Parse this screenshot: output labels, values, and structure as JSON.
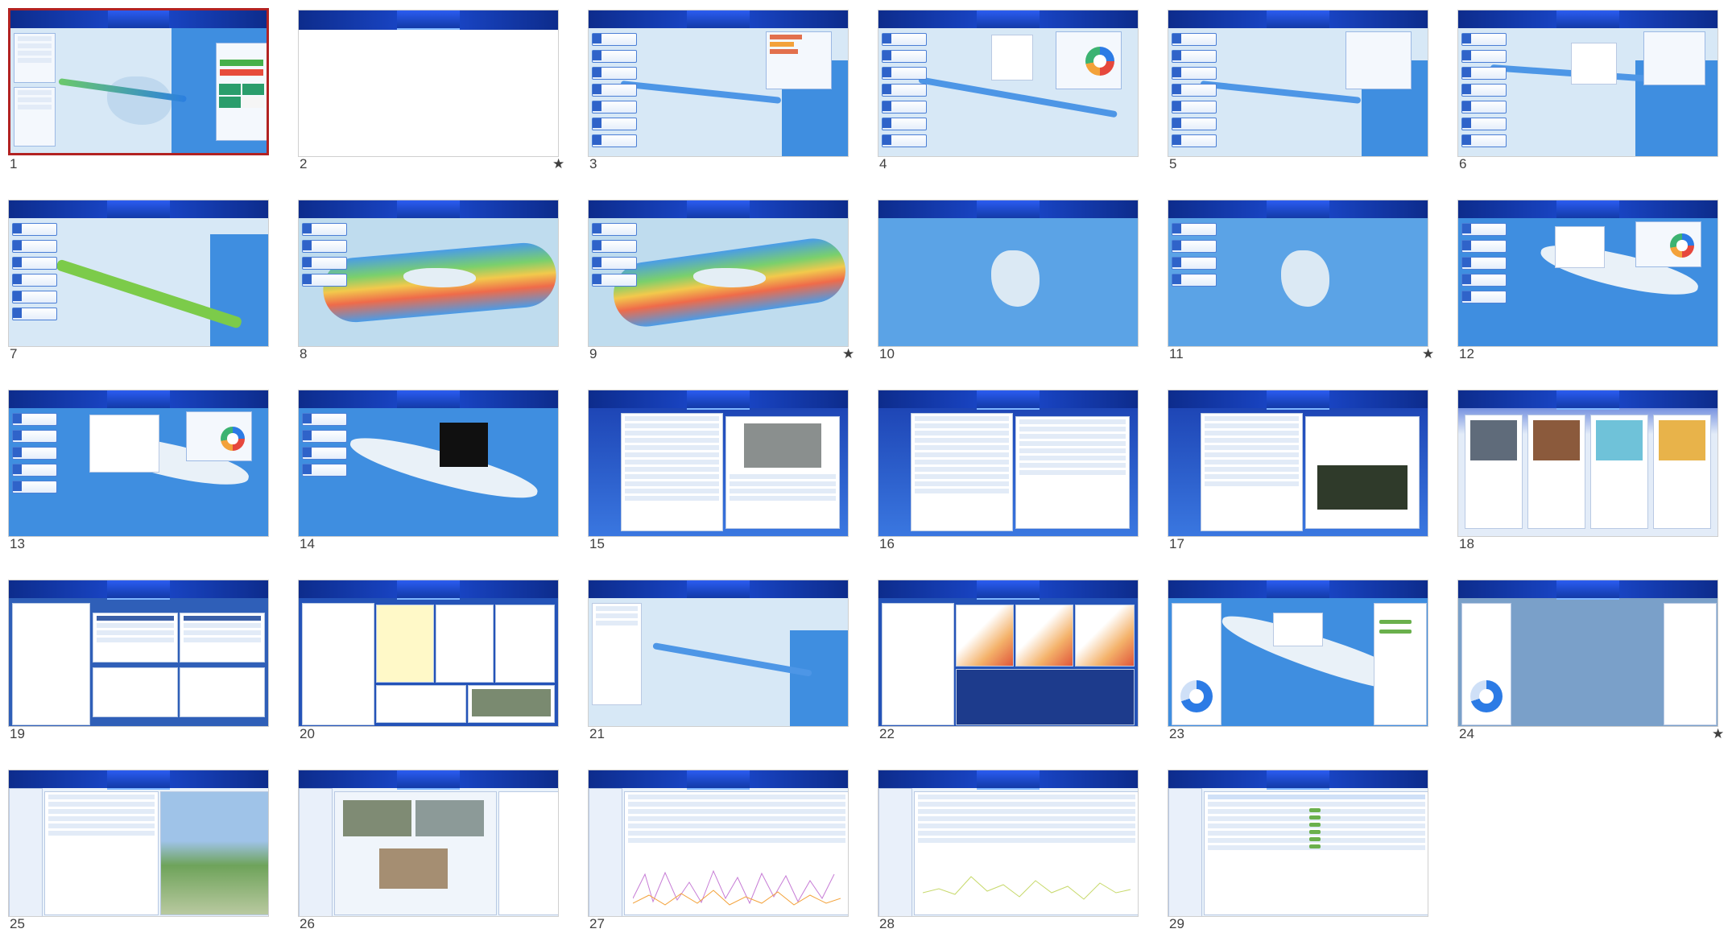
{
  "slides": [
    {
      "num": "1",
      "starred": false,
      "selected": true
    },
    {
      "num": "2",
      "starred": true,
      "selected": false
    },
    {
      "num": "3",
      "starred": false,
      "selected": false
    },
    {
      "num": "4",
      "starred": false,
      "selected": false
    },
    {
      "num": "5",
      "starred": false,
      "selected": false
    },
    {
      "num": "6",
      "starred": false,
      "selected": false
    },
    {
      "num": "7",
      "starred": false,
      "selected": false
    },
    {
      "num": "8",
      "starred": false,
      "selected": false
    },
    {
      "num": "9",
      "starred": true,
      "selected": false
    },
    {
      "num": "10",
      "starred": false,
      "selected": false
    },
    {
      "num": "11",
      "starred": true,
      "selected": false
    },
    {
      "num": "12",
      "starred": false,
      "selected": false
    },
    {
      "num": "13",
      "starred": false,
      "selected": false
    },
    {
      "num": "14",
      "starred": false,
      "selected": false
    },
    {
      "num": "15",
      "starred": false,
      "selected": false
    },
    {
      "num": "16",
      "starred": false,
      "selected": false
    },
    {
      "num": "17",
      "starred": false,
      "selected": false
    },
    {
      "num": "18",
      "starred": false,
      "selected": false
    },
    {
      "num": "19",
      "starred": false,
      "selected": false
    },
    {
      "num": "20",
      "starred": false,
      "selected": false
    },
    {
      "num": "21",
      "starred": false,
      "selected": false
    },
    {
      "num": "22",
      "starred": false,
      "selected": false
    },
    {
      "num": "23",
      "starred": false,
      "selected": false
    },
    {
      "num": "24",
      "starred": true,
      "selected": false
    },
    {
      "num": "25",
      "starred": false,
      "selected": false
    },
    {
      "num": "26",
      "starred": false,
      "selected": false
    },
    {
      "num": "27",
      "starred": false,
      "selected": false
    },
    {
      "num": "28",
      "starred": false,
      "selected": false
    },
    {
      "num": "29",
      "starred": false,
      "selected": false
    }
  ],
  "star_glyph": "★",
  "colors": {
    "selected_border": "#b22222",
    "header_blue": "#1c4bd3",
    "map_water": "#3f8ee0"
  }
}
